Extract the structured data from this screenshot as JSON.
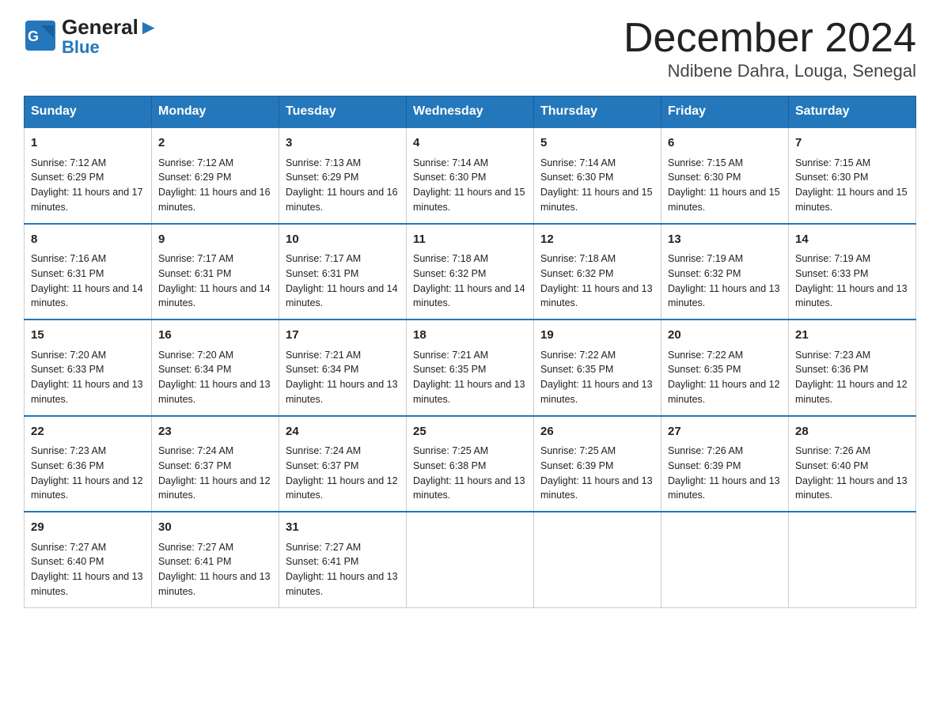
{
  "header": {
    "logo_general": "General",
    "logo_blue": "Blue",
    "month_title": "December 2024",
    "location": "Ndibene Dahra, Louga, Senegal"
  },
  "days_of_week": [
    "Sunday",
    "Monday",
    "Tuesday",
    "Wednesday",
    "Thursday",
    "Friday",
    "Saturday"
  ],
  "weeks": [
    [
      {
        "day": "1",
        "sunrise": "7:12 AM",
        "sunset": "6:29 PM",
        "daylight": "11 hours and 17 minutes."
      },
      {
        "day": "2",
        "sunrise": "7:12 AM",
        "sunset": "6:29 PM",
        "daylight": "11 hours and 16 minutes."
      },
      {
        "day": "3",
        "sunrise": "7:13 AM",
        "sunset": "6:29 PM",
        "daylight": "11 hours and 16 minutes."
      },
      {
        "day": "4",
        "sunrise": "7:14 AM",
        "sunset": "6:30 PM",
        "daylight": "11 hours and 15 minutes."
      },
      {
        "day": "5",
        "sunrise": "7:14 AM",
        "sunset": "6:30 PM",
        "daylight": "11 hours and 15 minutes."
      },
      {
        "day": "6",
        "sunrise": "7:15 AM",
        "sunset": "6:30 PM",
        "daylight": "11 hours and 15 minutes."
      },
      {
        "day": "7",
        "sunrise": "7:15 AM",
        "sunset": "6:30 PM",
        "daylight": "11 hours and 15 minutes."
      }
    ],
    [
      {
        "day": "8",
        "sunrise": "7:16 AM",
        "sunset": "6:31 PM",
        "daylight": "11 hours and 14 minutes."
      },
      {
        "day": "9",
        "sunrise": "7:17 AM",
        "sunset": "6:31 PM",
        "daylight": "11 hours and 14 minutes."
      },
      {
        "day": "10",
        "sunrise": "7:17 AM",
        "sunset": "6:31 PM",
        "daylight": "11 hours and 14 minutes."
      },
      {
        "day": "11",
        "sunrise": "7:18 AM",
        "sunset": "6:32 PM",
        "daylight": "11 hours and 14 minutes."
      },
      {
        "day": "12",
        "sunrise": "7:18 AM",
        "sunset": "6:32 PM",
        "daylight": "11 hours and 13 minutes."
      },
      {
        "day": "13",
        "sunrise": "7:19 AM",
        "sunset": "6:32 PM",
        "daylight": "11 hours and 13 minutes."
      },
      {
        "day": "14",
        "sunrise": "7:19 AM",
        "sunset": "6:33 PM",
        "daylight": "11 hours and 13 minutes."
      }
    ],
    [
      {
        "day": "15",
        "sunrise": "7:20 AM",
        "sunset": "6:33 PM",
        "daylight": "11 hours and 13 minutes."
      },
      {
        "day": "16",
        "sunrise": "7:20 AM",
        "sunset": "6:34 PM",
        "daylight": "11 hours and 13 minutes."
      },
      {
        "day": "17",
        "sunrise": "7:21 AM",
        "sunset": "6:34 PM",
        "daylight": "11 hours and 13 minutes."
      },
      {
        "day": "18",
        "sunrise": "7:21 AM",
        "sunset": "6:35 PM",
        "daylight": "11 hours and 13 minutes."
      },
      {
        "day": "19",
        "sunrise": "7:22 AM",
        "sunset": "6:35 PM",
        "daylight": "11 hours and 13 minutes."
      },
      {
        "day": "20",
        "sunrise": "7:22 AM",
        "sunset": "6:35 PM",
        "daylight": "11 hours and 12 minutes."
      },
      {
        "day": "21",
        "sunrise": "7:23 AM",
        "sunset": "6:36 PM",
        "daylight": "11 hours and 12 minutes."
      }
    ],
    [
      {
        "day": "22",
        "sunrise": "7:23 AM",
        "sunset": "6:36 PM",
        "daylight": "11 hours and 12 minutes."
      },
      {
        "day": "23",
        "sunrise": "7:24 AM",
        "sunset": "6:37 PM",
        "daylight": "11 hours and 12 minutes."
      },
      {
        "day": "24",
        "sunrise": "7:24 AM",
        "sunset": "6:37 PM",
        "daylight": "11 hours and 12 minutes."
      },
      {
        "day": "25",
        "sunrise": "7:25 AM",
        "sunset": "6:38 PM",
        "daylight": "11 hours and 13 minutes."
      },
      {
        "day": "26",
        "sunrise": "7:25 AM",
        "sunset": "6:39 PM",
        "daylight": "11 hours and 13 minutes."
      },
      {
        "day": "27",
        "sunrise": "7:26 AM",
        "sunset": "6:39 PM",
        "daylight": "11 hours and 13 minutes."
      },
      {
        "day": "28",
        "sunrise": "7:26 AM",
        "sunset": "6:40 PM",
        "daylight": "11 hours and 13 minutes."
      }
    ],
    [
      {
        "day": "29",
        "sunrise": "7:27 AM",
        "sunset": "6:40 PM",
        "daylight": "11 hours and 13 minutes."
      },
      {
        "day": "30",
        "sunrise": "7:27 AM",
        "sunset": "6:41 PM",
        "daylight": "11 hours and 13 minutes."
      },
      {
        "day": "31",
        "sunrise": "7:27 AM",
        "sunset": "6:41 PM",
        "daylight": "11 hours and 13 minutes."
      },
      null,
      null,
      null,
      null
    ]
  ]
}
